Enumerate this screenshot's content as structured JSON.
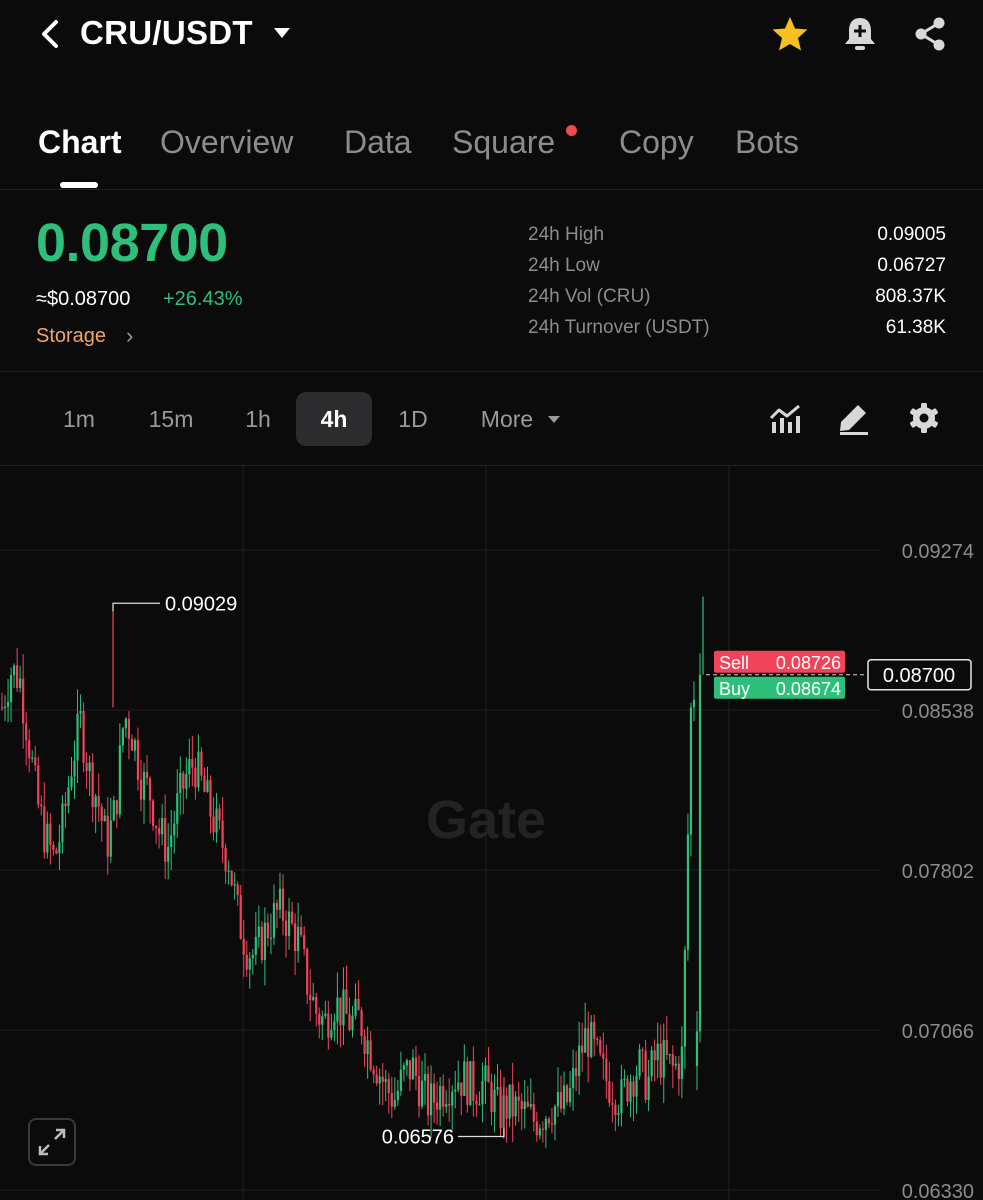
{
  "header": {
    "title": "CRU/USDT",
    "icons": {
      "back": "chevron-left-icon",
      "dropdown": "caret-down-icon",
      "favorite": "star-icon",
      "alert": "bell-plus-icon",
      "share": "share-icon"
    },
    "star_color": "#f5c021"
  },
  "tabs": [
    {
      "label": "Chart",
      "active": true
    },
    {
      "label": "Overview",
      "active": false
    },
    {
      "label": "Data",
      "active": false
    },
    {
      "label": "Square",
      "active": false,
      "badge_dot": true
    },
    {
      "label": "Copy",
      "active": false
    },
    {
      "label": "Bots",
      "active": false
    }
  ],
  "ticker": {
    "last_price": "0.08700",
    "usd_price": "≈$0.08700",
    "change_pct": "+26.43%",
    "tag": "Storage",
    "stats": [
      {
        "label": "24h High",
        "value": "0.09005"
      },
      {
        "label": "24h Low",
        "value": "0.06727"
      },
      {
        "label": "24h Vol (CRU)",
        "value": "808.37K"
      },
      {
        "label": "24h Turnover (USDT)",
        "value": "61.38K"
      }
    ]
  },
  "timeframes": {
    "items": [
      "1m",
      "15m",
      "1h",
      "4h",
      "1D"
    ],
    "active": "4h",
    "more_label": "More",
    "tools": [
      "indicators-icon",
      "draw-pencil-icon",
      "settings-gear-icon"
    ]
  },
  "colors": {
    "up": "#2ec07a",
    "down": "#f0445a",
    "grid": "#1f1f1f",
    "bg": "#0b0b0b"
  },
  "chart_data": {
    "type": "candlestick",
    "watermark": "Gate",
    "y_axis_ticks": [
      "0.09274",
      "0.08538",
      "0.07802",
      "0.07066",
      "0.06330"
    ],
    "ylim": [
      0.0633,
      0.09274
    ],
    "last_price_label": "0.08700",
    "sell": {
      "label": "Sell",
      "value": "0.08726"
    },
    "buy": {
      "label": "Buy",
      "value": "0.08674"
    },
    "max_annotation": "0.09029",
    "min_annotation": "0.06576",
    "close_path": [
      0.0855,
      0.0872,
      0.0869,
      0.0842,
      0.0812,
      0.0795,
      0.0785,
      0.0802,
      0.083,
      0.0848,
      0.0825,
      0.0812,
      0.0792,
      0.0808,
      0.0852,
      0.0842,
      0.0822,
      0.0815,
      0.0798,
      0.079,
      0.0808,
      0.0822,
      0.083,
      0.0818,
      0.0806,
      0.0795,
      0.0785,
      0.076,
      0.0745,
      0.074,
      0.075,
      0.0758,
      0.0762,
      0.0755,
      0.0748,
      0.0728,
      0.0715,
      0.071,
      0.072,
      0.0715,
      0.071,
      0.0712,
      0.07,
      0.069,
      0.068,
      0.0675,
      0.0685,
      0.069,
      0.068,
      0.0672,
      0.0678,
      0.0682,
      0.0685,
      0.0684,
      0.068,
      0.0682,
      0.0678,
      0.0668,
      0.0672,
      0.067,
      0.0668,
      0.0665,
      0.0668,
      0.0672,
      0.067,
      0.0675,
      0.0692,
      0.0705,
      0.0695,
      0.0685,
      0.068,
      0.0675,
      0.0685,
      0.069,
      0.0682,
      0.0695,
      0.0692,
      0.0688,
      0.0695,
      0.086,
      0.087
    ]
  },
  "expand_icon": "expand-arrows-icon"
}
